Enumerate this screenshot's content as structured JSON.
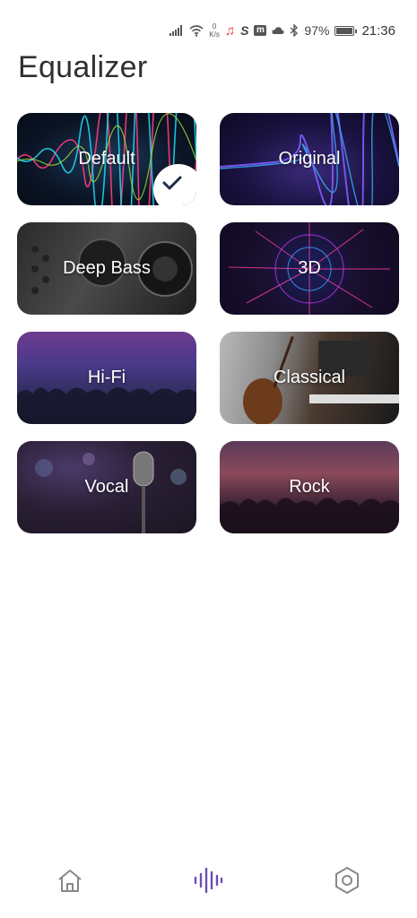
{
  "status_bar": {
    "net_speed_value": "0",
    "net_speed_unit": "K/s",
    "battery": "97%",
    "time": "21:36"
  },
  "page": {
    "title": "Equalizer"
  },
  "presets": [
    {
      "label": "Default",
      "selected": true
    },
    {
      "label": "Original",
      "selected": false
    },
    {
      "label": "Deep Bass",
      "selected": false
    },
    {
      "label": "3D",
      "selected": false
    },
    {
      "label": "Hi-Fi",
      "selected": false
    },
    {
      "label": "Classical",
      "selected": false
    },
    {
      "label": "Vocal",
      "selected": false
    },
    {
      "label": "Rock",
      "selected": false
    }
  ],
  "tabbar": {
    "active": "equalizer-tab",
    "accent_color": "#6a4fb6",
    "inactive_color": "#888888",
    "icons": [
      "home-icon",
      "soundwave-icon",
      "settings-hexagon-icon"
    ]
  }
}
